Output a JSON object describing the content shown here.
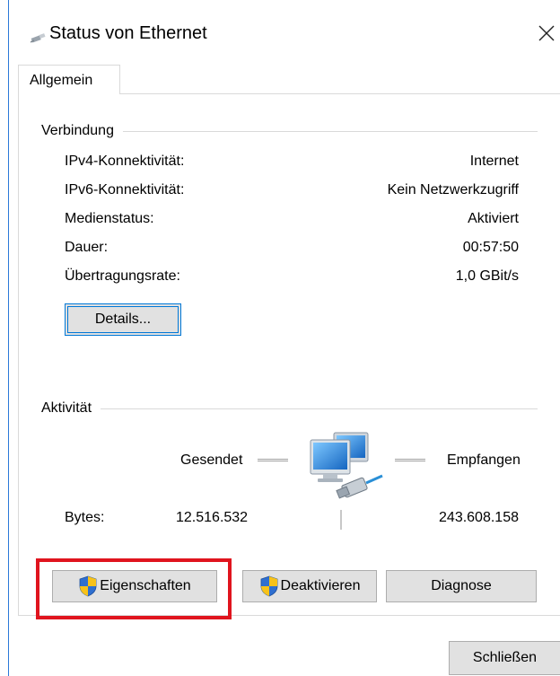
{
  "window": {
    "title": "Status von Ethernet",
    "title_icon": "network-plug-icon",
    "close_glyph": "✕"
  },
  "tabs": [
    {
      "label": "Allgemein",
      "selected": true
    }
  ],
  "connection": {
    "group_label": "Verbindung",
    "rows": [
      {
        "label": "IPv4-Konnektivität:",
        "value": "Internet"
      },
      {
        "label": "IPv6-Konnektivität:",
        "value": "Kein Netzwerkzugriff"
      },
      {
        "label": "Medienstatus:",
        "value": "Aktiviert"
      },
      {
        "label": "Dauer:",
        "value": "00:57:50"
      },
      {
        "label": "Übertragungsrate:",
        "value": "1,0 GBit/s"
      }
    ],
    "details_button": "Details..."
  },
  "activity": {
    "group_label": "Aktivität",
    "sent_label": "Gesendet",
    "received_label": "Empfangen",
    "bytes_label": "Bytes:",
    "bytes_sent": "12.516.532",
    "bytes_received": "243.608.158",
    "icon": "network-computers-icon"
  },
  "actions": {
    "properties_button": "Eigenschaften",
    "disable_button": "Deaktivieren",
    "diagnose_button": "Diagnose",
    "shield_icon": "uac-shield-icon"
  },
  "footer": {
    "close_button": "Schließen"
  },
  "colors": {
    "accent": "#0078d7",
    "highlight": "#e0141e",
    "button_face": "#e1e1e1"
  }
}
